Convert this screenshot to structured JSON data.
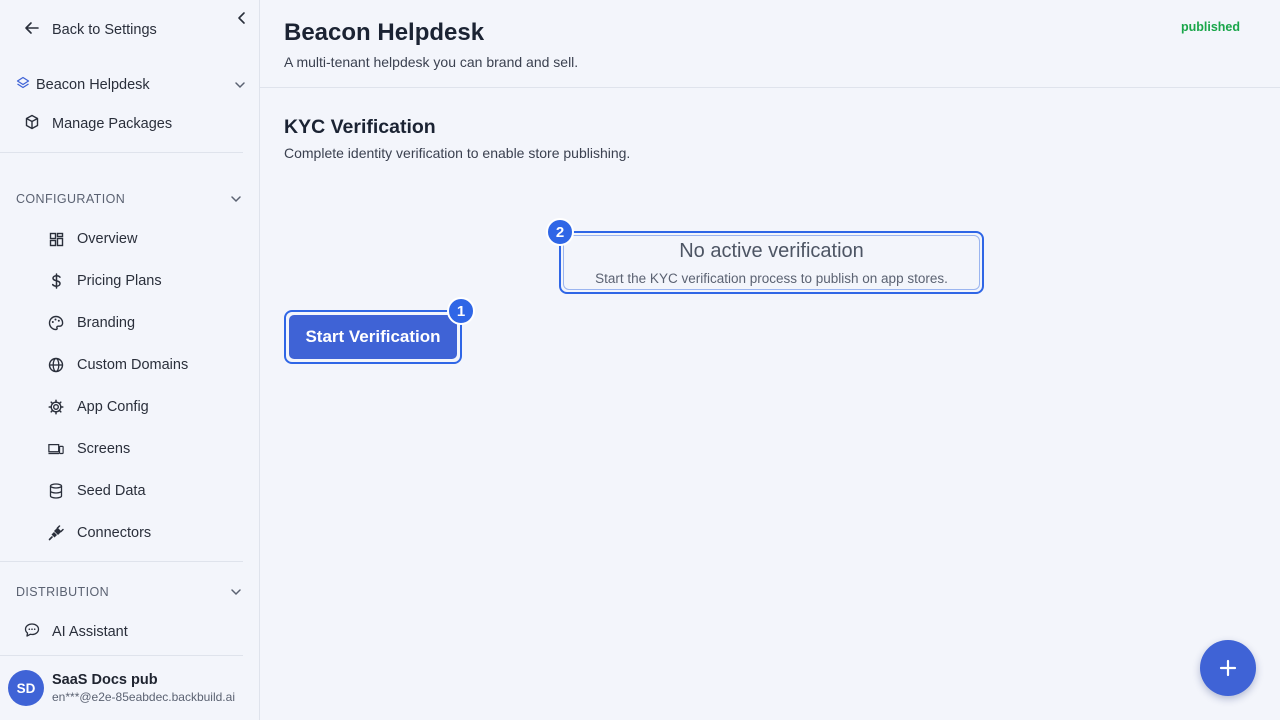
{
  "sidebar": {
    "back_label": "Back to Settings",
    "app_name": "Beacon Helpdesk",
    "manage_packages": "Manage Packages",
    "configuration_heading": "CONFIGURATION",
    "config_items": [
      {
        "label": "Overview",
        "icon": "grid-icon"
      },
      {
        "label": "Pricing Plans",
        "icon": "dollar-icon"
      },
      {
        "label": "Branding",
        "icon": "palette-icon"
      },
      {
        "label": "Custom Domains",
        "icon": "globe-icon"
      },
      {
        "label": "App Config",
        "icon": "gear-icon"
      },
      {
        "label": "Screens",
        "icon": "devices-icon"
      },
      {
        "label": "Seed Data",
        "icon": "database-icon"
      },
      {
        "label": "Connectors",
        "icon": "plug-icon"
      }
    ],
    "distribution_heading": "DISTRIBUTION",
    "ai_assistant": "AI Assistant",
    "user": {
      "initials": "SD",
      "name": "SaaS Docs pub",
      "email": "en***@e2e-85eabdec.backbuild.ai"
    }
  },
  "header": {
    "title": "Beacon Helpdesk",
    "subtitle": "A multi-tenant helpdesk you can brand and sell.",
    "status": "published"
  },
  "kyc": {
    "title": "KYC Verification",
    "subtitle": "Complete identity verification to enable store publishing.",
    "start_button": "Start Verification",
    "empty_title": "No active verification",
    "empty_desc": "Start the KYC verification process to publish on app stores."
  },
  "markers": {
    "one": "1",
    "two": "2"
  },
  "colors": {
    "accent": "#3f63d6",
    "highlight": "#2f66e6",
    "status": "#1aa64a",
    "background": "#f3f5fb"
  }
}
